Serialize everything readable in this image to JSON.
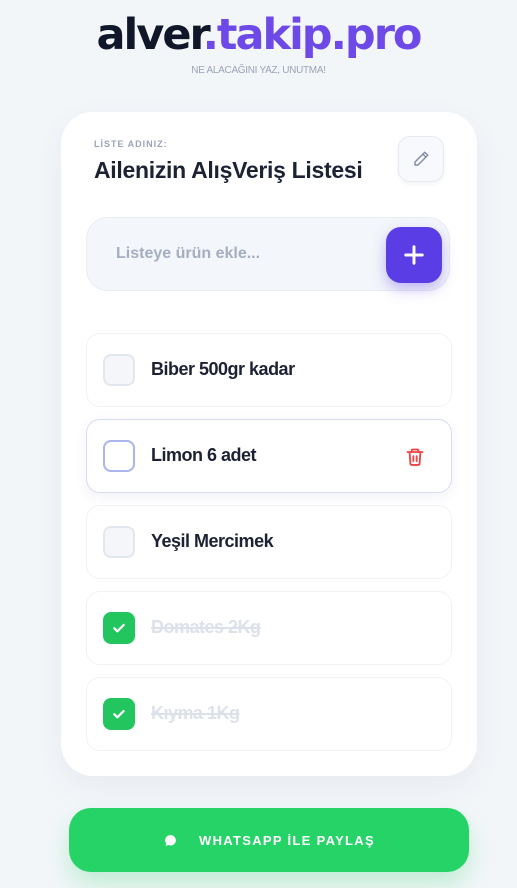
{
  "app": {
    "logo_part1": "alver",
    "logo_part2": ".takip.pro",
    "tagline": "NE ALACAĞINI YAZ, UNUTMA!"
  },
  "list": {
    "label": "LİSTE ADINIZ:",
    "title": "Ailenizin AlışVeriş Listesi"
  },
  "add": {
    "placeholder": "Listeye ürün ekle...",
    "value": ""
  },
  "items": [
    {
      "text": "Biber 500gr kadar",
      "checked": false
    },
    {
      "text": "Limon 6 adet",
      "checked": false
    },
    {
      "text": "Yeşil Mercimek",
      "checked": false
    },
    {
      "text": "Domates 2Kg",
      "checked": true
    },
    {
      "text": "Kıyma 1Kg",
      "checked": true
    }
  ],
  "share": {
    "label": "WHATSAPP İLE PAYLAŞ"
  },
  "icons": {
    "edit": "pencil-icon",
    "add": "plus-icon",
    "check": "check-icon",
    "delete": "trash-icon",
    "share": "whatsapp-icon"
  },
  "colors": {
    "accent": "#5b3de6",
    "success": "#22c55e",
    "whatsapp": "#25d366",
    "danger": "#ef4444"
  }
}
